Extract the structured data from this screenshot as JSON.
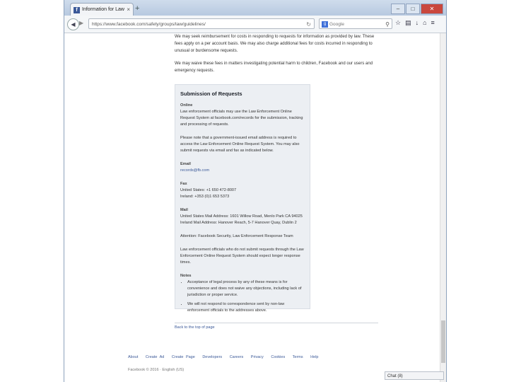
{
  "browser": {
    "tab_title": "Information for Law Enforcement...",
    "tab_close": "×",
    "new_tab": "+",
    "url": "https://www.facebook.com/safety/groups/law/guidelines/",
    "search_placeholder": "Google",
    "window_controls": [
      "–",
      "□",
      "✕"
    ]
  },
  "page": {
    "intro1": "We may seek reimbursement for costs in responding to requests for information as provided by law. These fees apply on a per account basis. We may also charge additional fees for costs incurred in responding to unusual or burdensome requests.",
    "intro2": "We may waive these fees in matters investigating potential harm to children, Facebook and our users and emergency requests.",
    "box": {
      "title": "Submission of Requests",
      "online_label": "Online",
      "online_text": "Law enforcement officials may use the Law Enforcement Online Request System at facebook.com/records for the submission, tracking and processing of requests.",
      "online_note": "Please note that a government-issued email address is required to access the Law Enforcement Online Request System. You may also submit requests via email and fax as indicated below.",
      "email_label": "Email",
      "email_value": "records@fb.com",
      "fax_label": "Fax",
      "fax_us": "United States: +1 650 472-8007",
      "fax_ie": "Ireland: +353 (0)1 653 5373",
      "mail_label": "Mail",
      "mail_text": "United States Mail Address: 1601 Willow Road, Menlo Park CA 94025 Ireland Mail Address: Hanover Reach, 5-7 Hanover Quay, Dublin 2",
      "attention": "Attention: Facebook Security, Law Enforcement Response Team",
      "non_le_text": "Law enforcement officials who do not submit requests through the Law Enforcement Online Request System should expect longer response times.",
      "notes_label": "Notes",
      "notes": [
        "Acceptance of legal process by any of these means is for convenience and does not waive any objections, including lack of jurisdiction or proper service.",
        "We will not respond to correspondence sent by non-law enforcement officials to the addresses above."
      ]
    },
    "back_to_top": "Back to the top of page"
  },
  "footer": {
    "links": [
      "About",
      "Create Ad",
      "Create Page",
      "Developers",
      "Careers",
      "Privacy",
      "Cookies",
      "Terms",
      "Help"
    ],
    "copyright": "Facebook © 2016 · English (US)"
  },
  "chat": {
    "label": "Chat (8)"
  }
}
